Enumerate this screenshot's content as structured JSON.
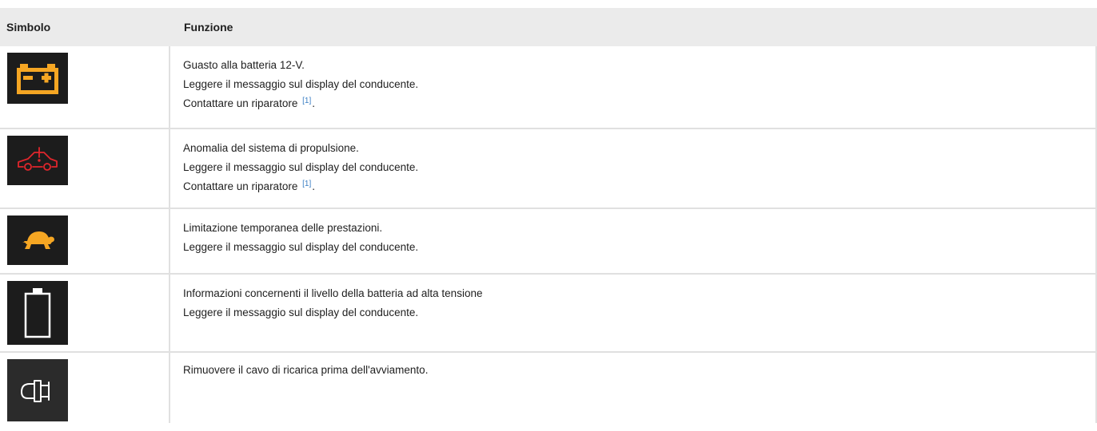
{
  "header": {
    "col_symbol": "Simbolo",
    "col_function": "Funzione"
  },
  "rows": [
    {
      "icon": "battery-12v-warning-icon",
      "icon_color": "#f5a623",
      "lines": [
        "Guasto alla batteria 12-V.",
        "Leggere il messaggio sul display del conducente."
      ],
      "link_line": "Contattare un riparatore",
      "footnote": "[1]",
      "link_suffix": "."
    },
    {
      "icon": "propulsion-system-fault-icon",
      "icon_color": "#e0262c",
      "lines": [
        "Anomalia del sistema di propulsione.",
        "Leggere il messaggio sul display del conducente."
      ],
      "link_line": "Contattare un riparatore",
      "footnote": "[1]",
      "link_suffix": "."
    },
    {
      "icon": "turtle-reduced-power-icon",
      "icon_color": "#f5a623",
      "lines": [
        "Limitazione temporanea delle prestazioni.",
        "Leggere il messaggio sul display del conducente."
      ]
    },
    {
      "icon": "high-voltage-battery-icon",
      "icon_color": "#ffffff",
      "lines": [
        "Informazioni concernenti il livello della batteria ad alta tensione",
        "Leggere il messaggio sul display del conducente."
      ]
    },
    {
      "icon": "charging-cable-plug-icon",
      "icon_color": "#ffffff",
      "lines": [
        "Rimuovere il cavo di ricarica prima dell'avviamento."
      ]
    }
  ]
}
